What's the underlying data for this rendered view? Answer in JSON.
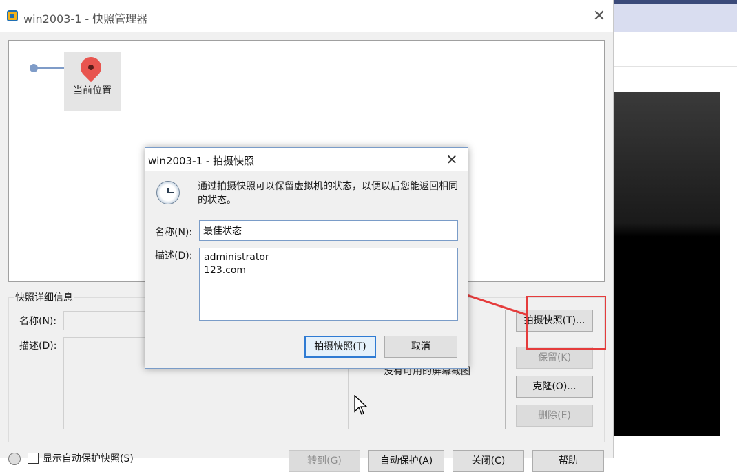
{
  "manager": {
    "title": "win2003-1 - 快照管理器",
    "tree": {
      "current_location_label": "当前位置"
    },
    "details": {
      "legend": "快照详细信息",
      "name_label": "名称(N):",
      "desc_label": "描述(D):",
      "no_screenshot": "没有可用的屏幕截图"
    },
    "buttons": {
      "take_snapshot": "拍摄快照(T)...",
      "keep": "保留(K)",
      "clone": "克隆(O)...",
      "delete": "删除(E)"
    },
    "bottom": {
      "show_autoprotect_label": "显示自动保护快照(S)",
      "goto": "转到(G)",
      "autoprotect": "自动保护(A)",
      "close": "关闭(C)",
      "help": "帮助"
    }
  },
  "dialog": {
    "title": "win2003-1 - 拍摄快照",
    "message": "通过拍摄快照可以保留虚拟机的状态，以便以后您能返回相同的状态。",
    "name_label": "名称(N):",
    "name_value": "最佳状态",
    "desc_label": "描述(D):",
    "desc_value": "administrator\n123.com\n",
    "take_button": "拍摄快照(T)",
    "cancel_button": "取消"
  },
  "colors": {
    "annotation_red": "#e53c3c",
    "dialog_border": "#7a9cc8",
    "pin_red": "#e8554f",
    "timeline_blue": "#7f9cc8"
  }
}
